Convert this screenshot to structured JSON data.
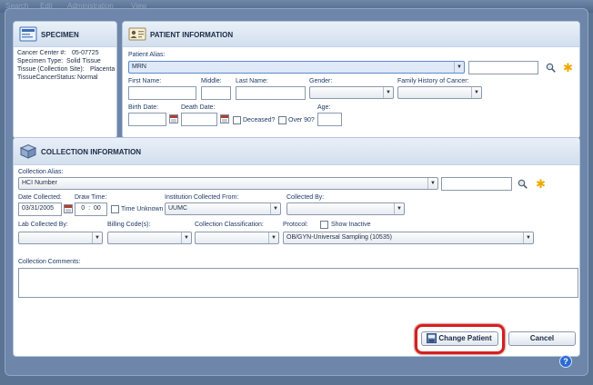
{
  "menu": {
    "items": [
      "Search",
      "Edit",
      "Administration",
      "View"
    ]
  },
  "specimen": {
    "title": "SPECIMEN",
    "rows": [
      {
        "label": "Cancer Center #:",
        "value": "05-07725"
      },
      {
        "label": "Specimen Type:",
        "value": "Solid Tissue"
      },
      {
        "label": "Tissue (Collection Site):",
        "value": "Placenta"
      },
      {
        "label": "TissueCancerStatus:",
        "value": "Normal"
      }
    ]
  },
  "patient": {
    "title": "PATIENT INFORMATION",
    "alias_label": "Patient Alias:",
    "alias_value": "MRN",
    "alias_text": "",
    "first_name_label": "First Name:",
    "middle_label": "Middle:",
    "last_name_label": "Last Name:",
    "gender_label": "Gender:",
    "family_history_label": "Family History of Cancer:",
    "birth_date_label": "Birth Date:",
    "death_date_label": "Death Date:",
    "deceased_label": "Deceased?",
    "over90_label": "Over 90?",
    "age_label": "Age:"
  },
  "collection": {
    "title": "COLLECTION INFORMATION",
    "alias_label": "Collection Alias:",
    "alias_value": "HCI Number",
    "date_collected_label": "Date Collected:",
    "date_collected_value": "03/31/2005",
    "draw_time_label": "Draw Time:",
    "draw_hour": "0",
    "draw_minute": "00",
    "time_unknown_label": "Time Unknown",
    "institution_label": "Institution Collected From:",
    "institution_value": "UUMC",
    "collected_by_label": "Collected By:",
    "lab_collected_by_label": "Lab Collected By:",
    "billing_codes_label": "Billing Code(s):",
    "classification_label": "Collection Classification:",
    "protocol_label": "Protocol:",
    "show_inactive_label": "Show Inactive",
    "protocol_value": "OB/GYN-Universal Sampling (10535)",
    "comments_label": "Collection Comments:"
  },
  "buttons": {
    "change_patient": "Change Patient",
    "cancel": "Cancel"
  },
  "help": "?",
  "colors": {
    "highlight_ring": "#d42020",
    "header_bg": "#dbe5f1",
    "dialog_bg": "#6d86a9"
  }
}
